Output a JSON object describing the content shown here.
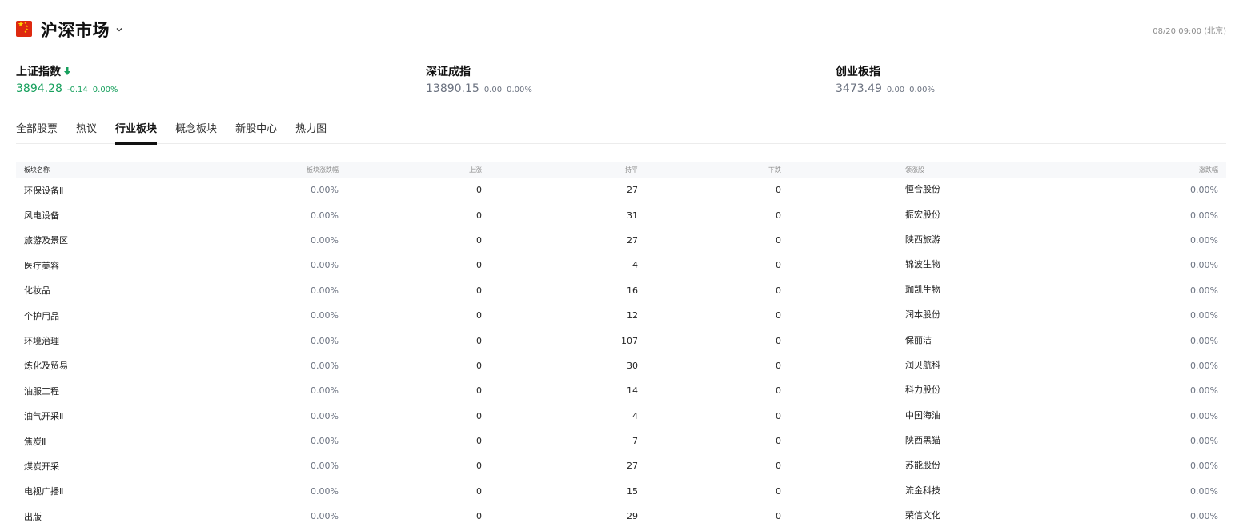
{
  "header": {
    "market_title": "沪深市场",
    "timestamp": "08/20 09:00 (北京)",
    "flag_icon": "china-flag-icon",
    "colors": {
      "up": "#17a05d",
      "neutral": "#6b7280",
      "flag_red": "#de2910",
      "flag_yellow": "#ffde00"
    }
  },
  "indices": [
    {
      "name": "上证指数",
      "price": "3894.28",
      "change": "-0.14",
      "pct": "0.00%",
      "trend": "down-arrow-icon"
    },
    {
      "name": "深证成指",
      "price": "13890.15",
      "change": "0.00",
      "pct": "0.00%"
    },
    {
      "name": "创业板指",
      "price": "3473.49",
      "change": "0.00",
      "pct": "0.00%"
    }
  ],
  "tabs": [
    {
      "label": "全部股票",
      "active": false
    },
    {
      "label": "热议",
      "active": false
    },
    {
      "label": "行业板块",
      "active": true
    },
    {
      "label": "概念板块",
      "active": false
    },
    {
      "label": "新股中心",
      "active": false
    },
    {
      "label": "热力图",
      "active": false
    }
  ],
  "table": {
    "headers": [
      "板块名称",
      "板块涨跌幅",
      "上涨",
      "持平",
      "下跌",
      "领涨股",
      "涨跌幅"
    ],
    "rows": [
      [
        "环保设备Ⅱ",
        "0.00%",
        "0",
        "27",
        "0",
        "恒合股份",
        "0.00%"
      ],
      [
        "风电设备",
        "0.00%",
        "0",
        "31",
        "0",
        "振宏股份",
        "0.00%"
      ],
      [
        "旅游及景区",
        "0.00%",
        "0",
        "27",
        "0",
        "陕西旅游",
        "0.00%"
      ],
      [
        "医疗美容",
        "0.00%",
        "0",
        "4",
        "0",
        "锦波生物",
        "0.00%"
      ],
      [
        "化妆品",
        "0.00%",
        "0",
        "16",
        "0",
        "珈凯生物",
        "0.00%"
      ],
      [
        "个护用品",
        "0.00%",
        "0",
        "12",
        "0",
        "润本股份",
        "0.00%"
      ],
      [
        "环境治理",
        "0.00%",
        "0",
        "107",
        "0",
        "保丽洁",
        "0.00%"
      ],
      [
        "炼化及贸易",
        "0.00%",
        "0",
        "30",
        "0",
        "润贝航科",
        "0.00%"
      ],
      [
        "油服工程",
        "0.00%",
        "0",
        "14",
        "0",
        "科力股份",
        "0.00%"
      ],
      [
        "油气开采Ⅱ",
        "0.00%",
        "0",
        "4",
        "0",
        "中国海油",
        "0.00%"
      ],
      [
        "焦炭Ⅱ",
        "0.00%",
        "0",
        "7",
        "0",
        "陕西黑猫",
        "0.00%"
      ],
      [
        "煤炭开采",
        "0.00%",
        "0",
        "27",
        "0",
        "苏能股份",
        "0.00%"
      ],
      [
        "电视广播Ⅱ",
        "0.00%",
        "0",
        "15",
        "0",
        "流金科技",
        "0.00%"
      ],
      [
        "出版",
        "0.00%",
        "0",
        "29",
        "0",
        "荣信文化",
        "0.00%"
      ]
    ]
  }
}
